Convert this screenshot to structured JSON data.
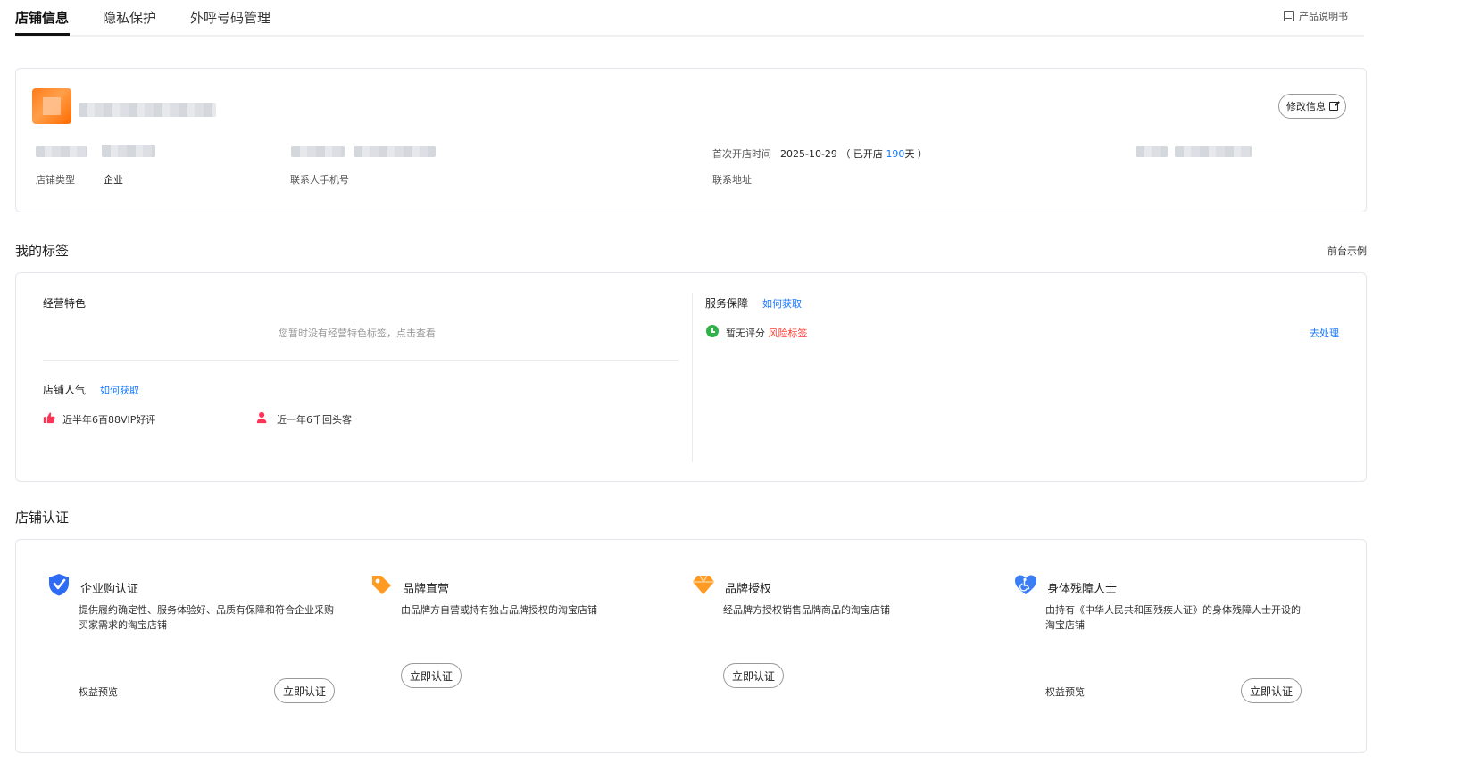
{
  "tabs": [
    {
      "label": "店铺信息"
    },
    {
      "label": "隐私保护"
    },
    {
      "label": "外呼号码管理"
    }
  ],
  "manual_label": "产品说明书",
  "shop": {
    "edit_label": "修改信息",
    "type_label": "店铺类型",
    "type_value": "企业",
    "phone_label": "联系人手机号",
    "open_label": "首次开店时间",
    "open_date": "2025-10-29",
    "open_prefix": "（ 已开店 ",
    "open_days": "190",
    "open_suffix": "天 ）",
    "address_label": "联系地址"
  },
  "tags_section": {
    "title": "我的标签",
    "example_link": "前台示例",
    "business_title": "经营特色",
    "business_empty": "您暂时没有经营特色标签，点击查看",
    "popularity_title": "店铺人气",
    "how_to_get": "如何获取",
    "popularity_items": [
      "近半年6百88VIP好评",
      "近一年6千回头客"
    ],
    "service_title": "服务保障",
    "service_how": "如何获取",
    "service_status": "暂无评分",
    "service_risk": "风险标签",
    "service_action": "去处理"
  },
  "cert_section": {
    "title": "店铺认证",
    "items": [
      {
        "title": "企业购认证",
        "desc": "提供履约确定性、服务体验好、品质有保障和符合企业采购买家需求的淘宝店铺",
        "perk": "权益预览",
        "button": "立即认证",
        "color": "#2f6cf6"
      },
      {
        "title": "品牌直营",
        "desc": "由品牌方自营或持有独占品牌授权的淘宝店铺",
        "perk": "",
        "button": "立即认证",
        "color": "#ff9b22"
      },
      {
        "title": "品牌授权",
        "desc": "经品牌方授权销售品牌商品的淘宝店铺",
        "perk": "",
        "button": "立即认证",
        "color": "#ff9b22"
      },
      {
        "title": "身体残障人士",
        "desc": "由持有《中华人民共和国残疾人证》的身体残障人士开设的淘宝店铺",
        "perk": "权益预览",
        "button": "立即认证",
        "color": "#3a7df6"
      }
    ]
  }
}
